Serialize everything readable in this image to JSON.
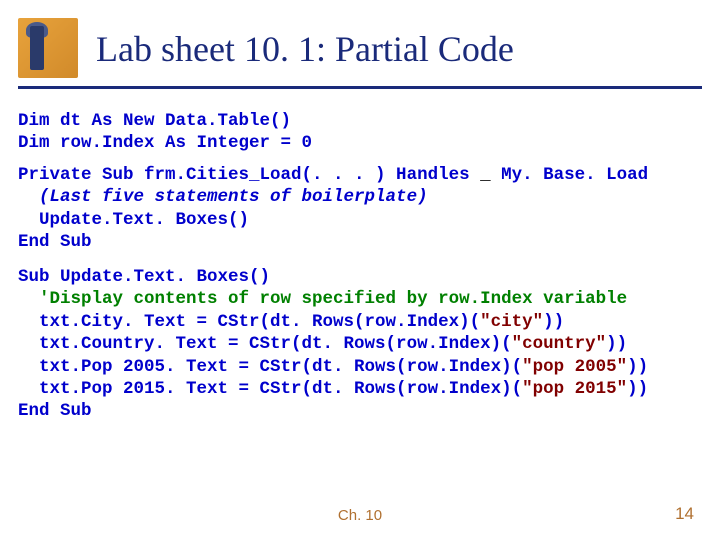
{
  "title": "Lab sheet 10. 1: Partial Code",
  "code": {
    "l1": "Dim dt As New Data.Table()",
    "l2": "Dim row.Index As Integer = 0",
    "l3a": "Private Sub frm.Cities_Load(. . . ) Handles ",
    "l3b": "_",
    "l3c": " My. Base. Load",
    "l4": "  (Last five statements of boilerplate)",
    "l5": "  Update.Text. Boxes()",
    "l6": "End Sub",
    "l7": "Sub Update.Text. Boxes()",
    "l8": "  'Display contents of row specified by row.Index variable",
    "l9a": "  txt.City. Text = CStr(dt. Rows(row.Index)(",
    "l9b": "\"city\"",
    "l9c": "))",
    "l10a": "  txt.Country. Text = CStr(dt. Rows(row.Index)(",
    "l10b": "\"country\"",
    "l10c": "))",
    "l11a": "  txt.Pop 2005. Text = CStr(dt. Rows(row.Index)(",
    "l11b": "\"pop 2005\"",
    "l11c": "))",
    "l12a": "  txt.Pop 2015. Text = CStr(dt. Rows(row.Index)(",
    "l12b": "\"pop 2015\"",
    "l12c": "))",
    "l13": "End Sub"
  },
  "footer_center": "Ch. 10",
  "footer_right": "14"
}
